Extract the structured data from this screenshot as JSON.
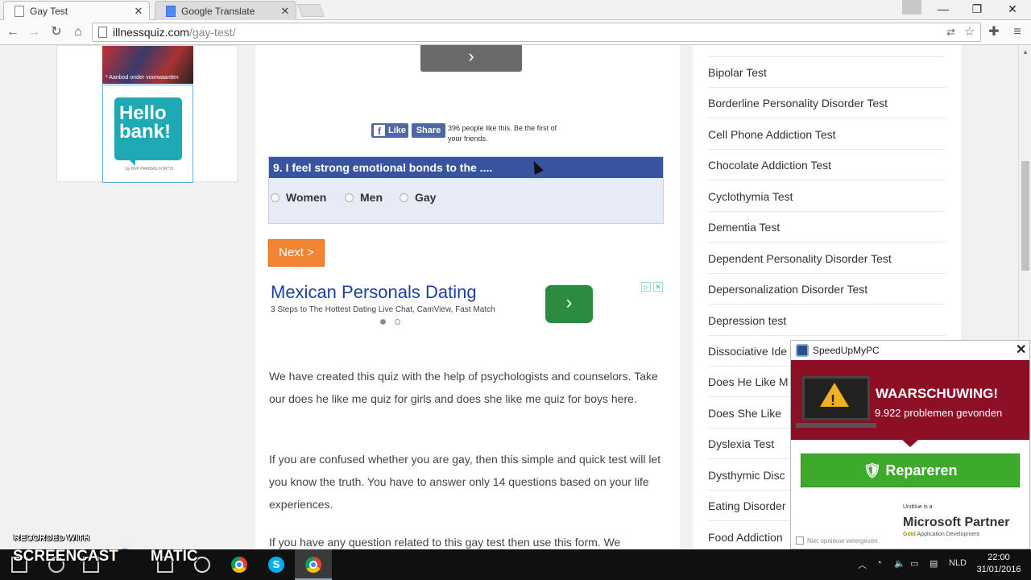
{
  "browser": {
    "tabs": [
      {
        "title": "Gay Test",
        "active": true
      },
      {
        "title": "Google Translate",
        "active": false
      }
    ],
    "url_domain": "illnessquiz.com",
    "url_path": "/gay-test/"
  },
  "left_ad": {
    "caption": "* Aanbod onder voorwaarden",
    "hello_text": "Hello bank!",
    "hello_sub": "by BNP PARIBAS FORTIS"
  },
  "social": {
    "like_label": "Like",
    "share_label": "Share",
    "like_text": "396 people like this. Be the first of your friends."
  },
  "quiz": {
    "question": "9. I feel strong emotional bonds to the ....",
    "options": [
      "Women",
      "Men",
      "Gay"
    ],
    "next_label": "Next >"
  },
  "ad": {
    "title": "Mexican Personals Dating",
    "subtitle": "3 Steps to The Hottest Dating Live Chat, CamView, Fast Match"
  },
  "article": {
    "paragraphs": [
      "We have created this quiz with the help of psychologists and counselors. Take our does he like me quiz for girls and does she like me quiz for boys here.",
      "If you are confused whether you are gay, then this simple and quick test will let you know the truth. You have to answer only 14 questions based on your life experiences.",
      "If you have any question related to this gay test then use this form. We"
    ]
  },
  "sidebar": {
    "items": [
      "Bipolar Test",
      "Borderline Personality Disorder Test",
      "Cell Phone Addiction Test",
      "Chocolate Addiction Test",
      "Cyclothymia Test",
      "Dementia Test",
      "Dependent Personality Disorder Test",
      "Depersonalization Disorder Test",
      "Depression test",
      "Dissociative Ide",
      "Does He Like M",
      "Does She Like",
      "Dyslexia Test",
      "Dysthymic Disc",
      "Eating Disorder",
      "Food Addiction"
    ]
  },
  "popup": {
    "app_name": "SpeedUpMyPC",
    "warning_title": "WAARSCHUWING!",
    "warning_text": "9.922 problemen gevonden",
    "repair_label": "Repareren",
    "ms_small": "Uniblue is a",
    "ms_big": "Microsoft Partner",
    "ms_gold": "Gold",
    "ms_sub": "Application Development",
    "dont_show": "Niet opnieuw weergeven"
  },
  "watermark": {
    "small": "RECORDED WITH",
    "big_left": "SCREENCAST",
    "big_right": "MATIC"
  },
  "taskbar": {
    "language": "NLD",
    "time": "22:00",
    "date": "31/01/2016"
  }
}
